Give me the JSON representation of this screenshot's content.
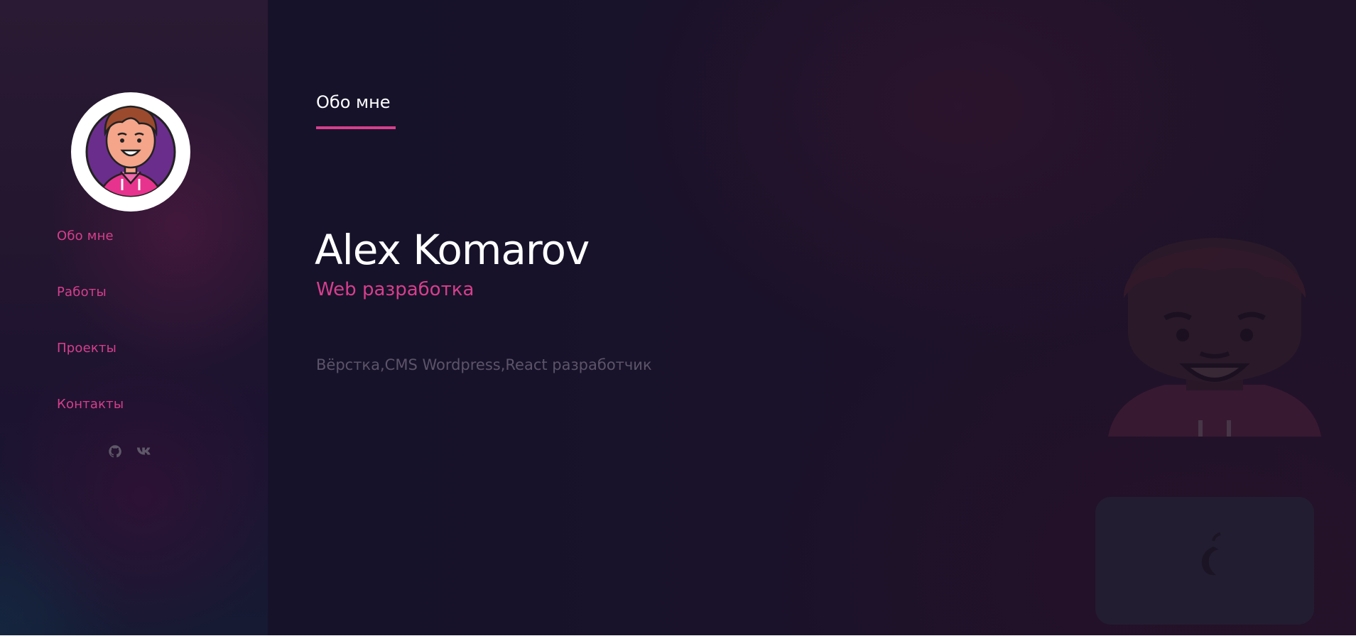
{
  "sidebar": {
    "nav": [
      {
        "label": "Обо мне"
      },
      {
        "label": "Работы"
      },
      {
        "label": "Проекты"
      },
      {
        "label": "Контакты"
      }
    ],
    "socials": [
      {
        "icon": "github-icon"
      },
      {
        "icon": "vk-icon"
      }
    ]
  },
  "main": {
    "tab_label": "Обо мне",
    "name": "Alex Komarov",
    "role": "Web разработка",
    "skills": "Вёрстка,CMS Wordpress,React разработчик"
  },
  "colors": {
    "accent": "#d63f8c",
    "text": "#ffffff",
    "muted": "#5c5468",
    "background": "#17122a"
  }
}
